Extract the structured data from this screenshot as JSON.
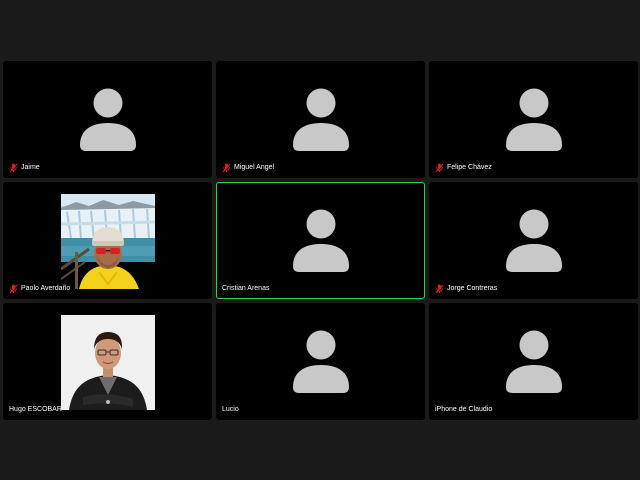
{
  "participants": [
    {
      "name": "Jaime",
      "muted": true,
      "avatar": "placeholder",
      "active": false
    },
    {
      "name": "Miguel Angel",
      "muted": true,
      "avatar": "placeholder",
      "active": false
    },
    {
      "name": "Felipe Chávez",
      "muted": true,
      "avatar": "placeholder",
      "active": false
    },
    {
      "name": "Paolo Averdaño",
      "muted": true,
      "avatar": "video-glacier",
      "active": false
    },
    {
      "name": "Cristian Arenas",
      "muted": false,
      "avatar": "placeholder",
      "active": true
    },
    {
      "name": "Jorge Contreras",
      "muted": true,
      "avatar": "placeholder",
      "active": false
    },
    {
      "name": "Hugo ESCOBAR",
      "muted": false,
      "avatar": "video-portrait",
      "active": false
    },
    {
      "name": "Lucio",
      "muted": false,
      "avatar": "placeholder",
      "active": false
    },
    {
      "name": "iPhone de Claudio",
      "muted": false,
      "avatar": "placeholder",
      "active": false
    }
  ],
  "icons": {
    "muted": "microphone-muted-icon",
    "placeholder": "user-placeholder-icon"
  },
  "colors": {
    "background": "#1a1a1a",
    "tile": "#000000",
    "placeholder": "#c8c8c8",
    "active_speaker_border": "#2dd255",
    "muted_icon": "#e0242e",
    "name_text": "#ffffff"
  }
}
